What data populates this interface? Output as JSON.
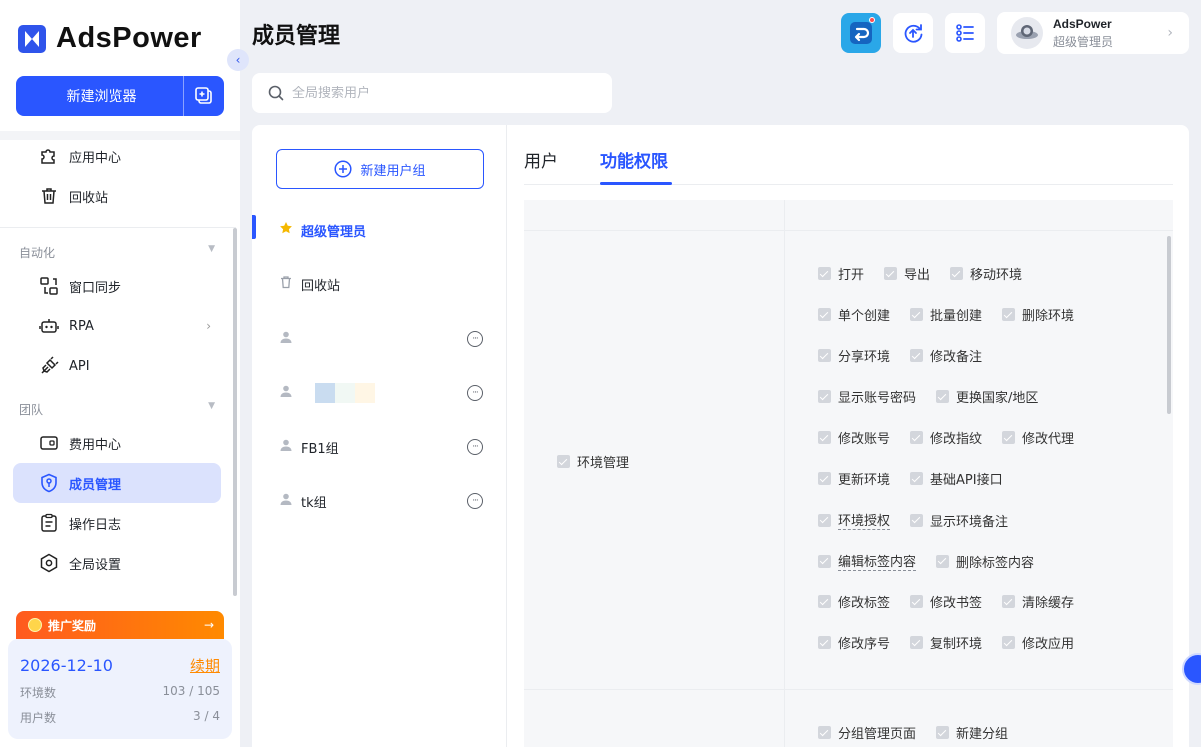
{
  "app": {
    "logo_text": "AdsPower",
    "accent_color": "#2a56ff"
  },
  "sidebar": {
    "new_browser_label": "新建浏览器",
    "items_top": [
      {
        "label": "应用中心",
        "icon": "puzzle-icon"
      },
      {
        "label": "回收站",
        "icon": "trash-icon"
      }
    ],
    "section_automation": "自动化",
    "items_automation": [
      {
        "label": "窗口同步",
        "icon": "window-sync-icon"
      },
      {
        "label": "RPA",
        "icon": "robot-icon"
      },
      {
        "label": "API",
        "icon": "plug-icon"
      }
    ],
    "section_team": "团队",
    "items_team": [
      {
        "label": "费用中心",
        "icon": "wallet-icon"
      },
      {
        "label": "成员管理",
        "icon": "shield-key-icon",
        "active": true
      },
      {
        "label": "操作日志",
        "icon": "clipboard-icon"
      },
      {
        "label": "全局设置",
        "icon": "settings-hex-icon"
      }
    ],
    "promo_label": "推广奖励",
    "promo_arrow": "→",
    "plan": {
      "expiry_date": "2026-12-10",
      "renew_label": "续期",
      "profiles_label": "环境数",
      "profiles_value": "103 / 105",
      "users_label": "用户数",
      "users_value": "3 / 4"
    }
  },
  "header": {
    "title": "成员管理",
    "user_name": "AdsPower",
    "user_role": "超级管理员"
  },
  "search": {
    "placeholder": "全局搜索用户"
  },
  "groups": {
    "new_group_label": "新建用户组",
    "items": [
      {
        "label": "超级管理员",
        "icon": "star-icon",
        "active": true
      },
      {
        "label": "回收站",
        "icon": "trash-icon"
      },
      {
        "label": "",
        "icon": "user-icon"
      },
      {
        "label": "",
        "icon": "user-icon"
      },
      {
        "label": "FB1组",
        "icon": "user-icon"
      },
      {
        "label": "tk组",
        "icon": "user-icon"
      }
    ]
  },
  "tabs": [
    {
      "label": "用户"
    },
    {
      "label": "功能权限",
      "active": true
    }
  ],
  "permissions": {
    "category": "环境管理",
    "rows": [
      [
        "打开",
        "导出",
        "移动环境"
      ],
      [
        "单个创建",
        "批量创建",
        "删除环境"
      ],
      [
        "分享环境",
        "修改备注"
      ],
      [
        "显示账号密码",
        "更换国家/地区"
      ],
      [
        "修改账号",
        "修改指纹",
        "修改代理"
      ],
      [
        "更新环境",
        "基础API接口"
      ],
      [
        "环境授权",
        "显示环境备注"
      ],
      [
        "编辑标签内容",
        "删除标签内容"
      ],
      [
        "修改标签",
        "修改书签",
        "清除缓存"
      ],
      [
        "修改序号",
        "复制环境",
        "修改应用"
      ]
    ],
    "next_rows": [
      [
        "分组管理页面",
        "新建分组"
      ]
    ]
  }
}
